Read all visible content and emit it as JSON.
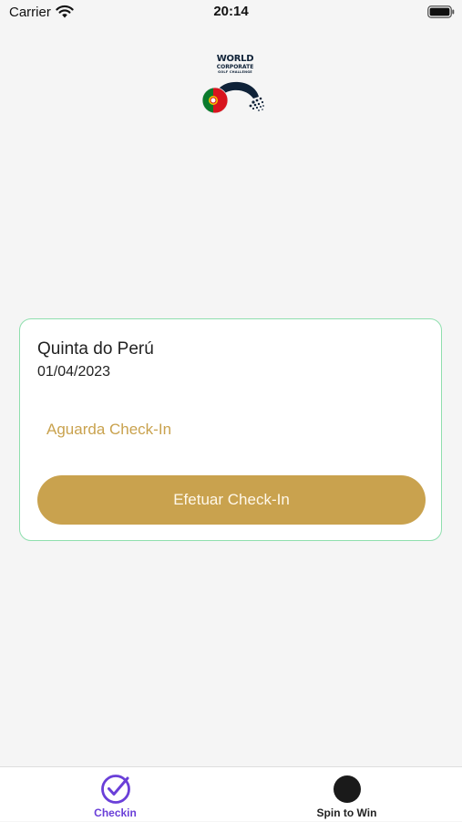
{
  "status_bar": {
    "carrier": "Carrier",
    "time": "20:14",
    "icons": [
      "wifi-icon",
      "battery-icon"
    ]
  },
  "logo": {
    "line1": "WORLD",
    "line2": "CORPORATE",
    "line3": "GOLF CHALLENGE",
    "flag": "portugal-flag"
  },
  "card": {
    "venue": "Quinta do Perú",
    "date": "01/04/2023",
    "status": "Aguarda Check-In",
    "button_label": "Efetuar Check-In"
  },
  "tab_bar": {
    "tabs": [
      {
        "label": "Checkin",
        "icon": "check-circle-icon",
        "active": true
      },
      {
        "label": "Spin to Win",
        "icon": "spin-circle-icon",
        "active": false
      }
    ]
  },
  "colors": {
    "accent_gold": "#c9a24e",
    "card_border": "#8fdfae",
    "active_tab": "#6a3fd8",
    "background": "#f5f5f5"
  }
}
